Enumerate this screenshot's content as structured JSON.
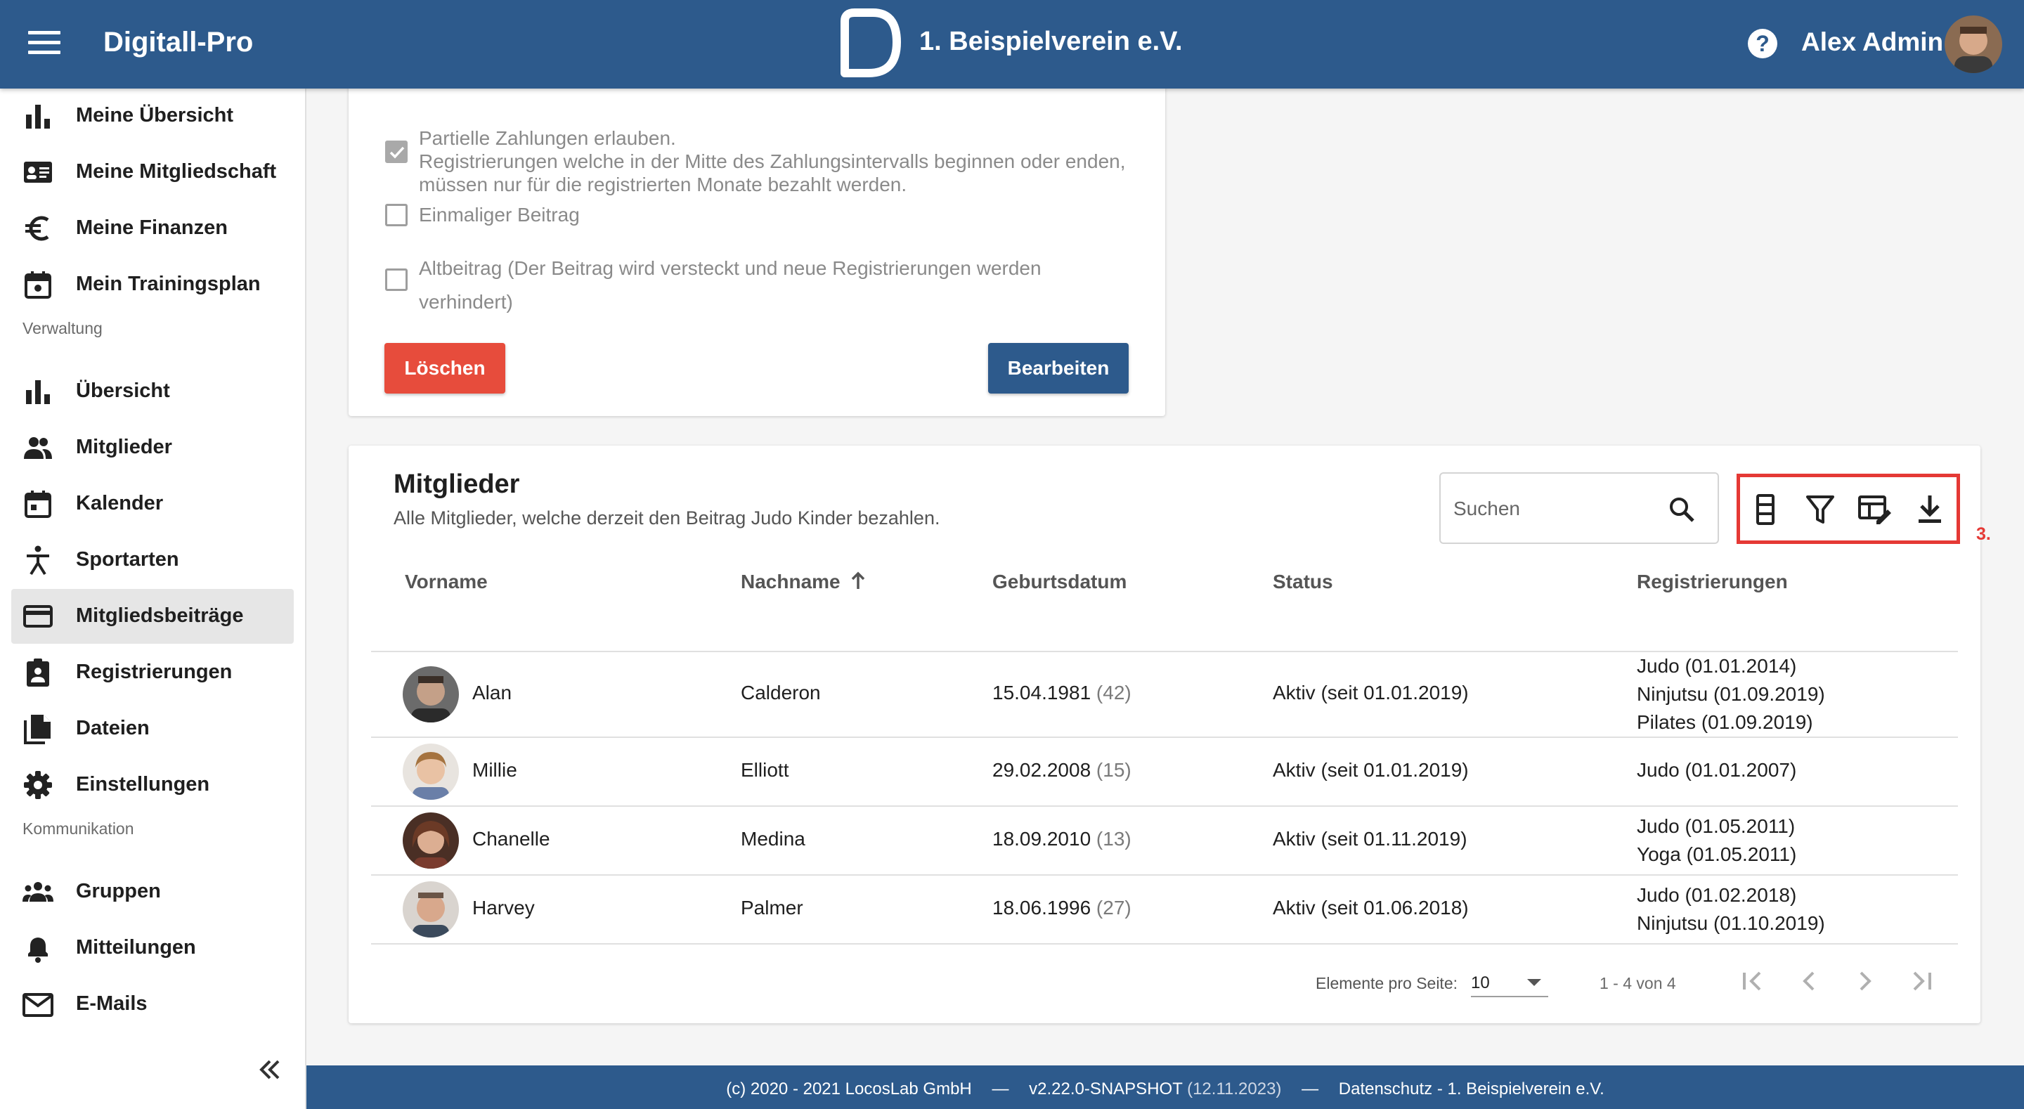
{
  "header": {
    "app_title": "Digitall-Pro",
    "club_name": "1. Beispielverein e.V.",
    "user_name": "Alex Admin",
    "help_glyph": "?",
    "brand_color": "#2d5a8c"
  },
  "sidebar": {
    "personal_items": [
      {
        "label": "Meine Übersicht",
        "icon": "bar-chart-icon"
      },
      {
        "label": "Meine Mitgliedschaft",
        "icon": "id-card-icon"
      },
      {
        "label": "Meine Finanzen",
        "icon": "euro-icon"
      },
      {
        "label": "Mein Trainingsplan",
        "icon": "calendar-icon"
      }
    ],
    "section_admin": "Verwaltung",
    "admin_items": [
      {
        "label": "Übersicht",
        "icon": "bar-chart-icon"
      },
      {
        "label": "Mitglieder",
        "icon": "people-icon"
      },
      {
        "label": "Kalender",
        "icon": "calendar-icon"
      },
      {
        "label": "Sportarten",
        "icon": "sport-icon"
      },
      {
        "label": "Mitgliedsbeiträge",
        "icon": "credit-card-icon",
        "active": true
      },
      {
        "label": "Registrierungen",
        "icon": "clipboard-user-icon"
      },
      {
        "label": "Dateien",
        "icon": "file-icon"
      },
      {
        "label": "Einstellungen",
        "icon": "gear-icon"
      }
    ],
    "section_comm": "Kommunikation",
    "comm_items": [
      {
        "label": "Gruppen",
        "icon": "group-icon"
      },
      {
        "label": "Mitteilungen",
        "icon": "bell-icon"
      },
      {
        "label": "E-Mails",
        "icon": "mail-icon"
      }
    ]
  },
  "fee_card": {
    "options": [
      {
        "text": "Partielle Zahlungen erlauben.",
        "subtext": "Registrierungen welche in der Mitte des Zahlungsintervalls beginnen oder enden, müssen nur für die registrierten Monate bezahlt werden.",
        "checked": true
      },
      {
        "text": "Einmaliger Beitrag",
        "checked": false
      },
      {
        "text": "Altbeitrag (Der Beitrag wird versteckt und neue Registrierungen werden verhindert)",
        "checked": false
      }
    ],
    "delete_label": "Löschen",
    "edit_label": "Bearbeiten"
  },
  "members": {
    "title": "Mitglieder",
    "subtitle": "Alle Mitglieder, welche derzeit den Beitrag Judo Kinder bezahlen.",
    "search_placeholder": "Suchen",
    "toolbar_note": "3.",
    "columns": [
      "Vorname",
      "Nachname",
      "Geburtsdatum",
      "Status",
      "Registrierungen"
    ],
    "rows": [
      {
        "first": "Alan",
        "last": "Calderon",
        "birth": "15.04.1981",
        "age": "(42)",
        "status": "Aktiv",
        "since": "(seit 01.01.2019)",
        "regs": [
          "Judo (01.01.2014)",
          "Ninjutsu (01.09.2019)",
          "Pilates (01.09.2019)"
        ]
      },
      {
        "first": "Millie",
        "last": "Elliott",
        "birth": "29.02.2008",
        "age": "(15)",
        "status": "Aktiv",
        "since": "(seit 01.01.2019)",
        "regs": [
          "Judo (01.01.2007)"
        ]
      },
      {
        "first": "Chanelle",
        "last": "Medina",
        "birth": "18.09.2010",
        "age": "(13)",
        "status": "Aktiv",
        "since": "(seit 01.11.2019)",
        "regs": [
          "Judo (01.05.2011)",
          "Yoga (01.05.2011)"
        ]
      },
      {
        "first": "Harvey",
        "last": "Palmer",
        "birth": "18.06.1996",
        "age": "(27)",
        "status": "Aktiv",
        "since": "(seit 01.06.2018)",
        "regs": [
          "Judo (01.02.2018)",
          "Ninjutsu (01.10.2019)"
        ]
      }
    ],
    "pagination": {
      "per_page_label": "Elemente pro Seite:",
      "per_page": "10",
      "range": "1 - 4 von 4"
    }
  },
  "footer": {
    "copyright": "(c) 2020 - 2021 LocosLab GmbH",
    "sep": "—",
    "version": "v2.22.0-SNAPSHOT",
    "build_date": "(12.11.2023)",
    "privacy": "Datenschutz - 1. Beispielverein e.V."
  }
}
